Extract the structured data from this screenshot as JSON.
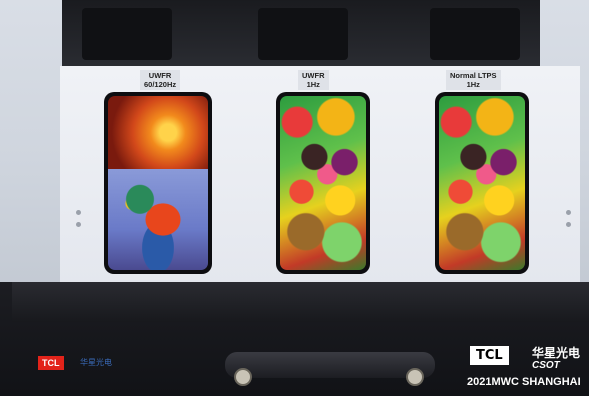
{
  "labels": {
    "left": "UWFR\n60/120Hz",
    "center": "UWFR\n1Hz",
    "right": "Normal LTPS\n1Hz"
  },
  "base": {
    "tcl_badge": "TCL",
    "logo": "TCL",
    "cn_brand": "华星光电",
    "csot": "CSOT",
    "event": "2021MWC SHANGHAI"
  }
}
